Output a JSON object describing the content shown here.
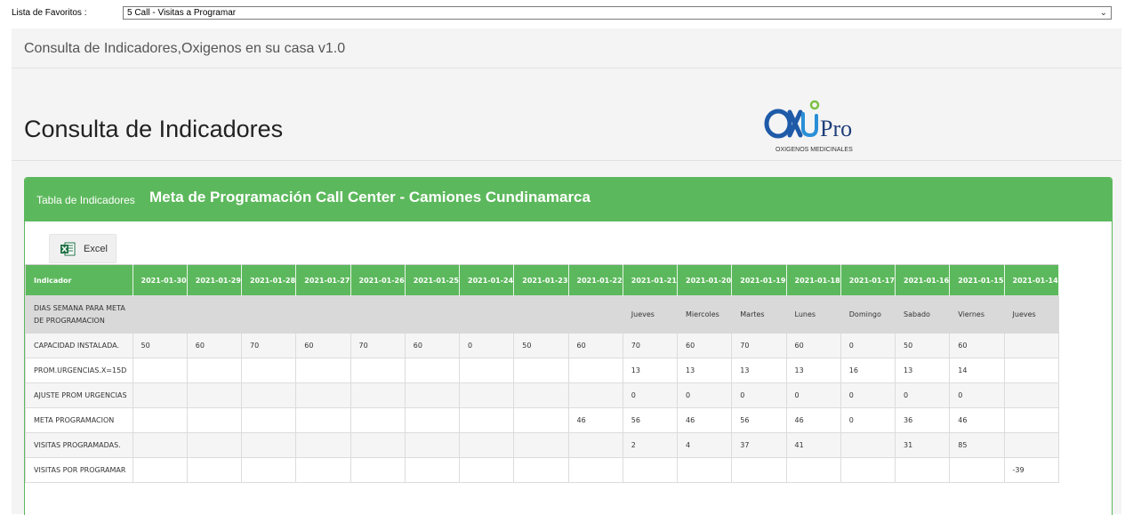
{
  "favorites": {
    "label": "Lista de Favoritos :",
    "selected": "5 Call - Visitas a Programar"
  },
  "app_title": "Consulta de Indicadores,Oxigenos en su casa v1.0",
  "page_title": "Consulta de Indicadores",
  "logo": {
    "brand": "Pro",
    "tagline": "OXIGENOS MEDICINALES"
  },
  "card": {
    "label": "Tabla de Indicadores",
    "title": "Meta de Programación Call Center - Camiones Cundinamarca"
  },
  "excel_button": {
    "label": "Excel"
  },
  "table": {
    "headers": [
      "Indicador",
      "2021-01-30",
      "2021-01-29",
      "2021-01-28",
      "2021-01-27",
      "2021-01-26",
      "2021-01-25",
      "2021-01-24",
      "2021-01-23",
      "2021-01-22",
      "2021-01-21",
      "2021-01-20",
      "2021-01-19",
      "2021-01-18",
      "2021-01-17",
      "2021-01-16",
      "2021-01-15",
      "2021-01-14"
    ],
    "rows": [
      [
        "DIAS SEMANA PARA META DE PROGRAMACION",
        "",
        "",
        "",
        "",
        "",
        "",
        "",
        "",
        "",
        "Jueves",
        "Miercoles",
        "Martes",
        "Lunes",
        "Domingo",
        "Sabado",
        "Viernes",
        "Jueves"
      ],
      [
        "CAPACIDAD INSTALADA.",
        "50",
        "60",
        "70",
        "60",
        "70",
        "60",
        "0",
        "50",
        "60",
        "70",
        "60",
        "70",
        "60",
        "0",
        "50",
        "60",
        ""
      ],
      [
        "PROM.URGENCIAS.X=15D",
        "",
        "",
        "",
        "",
        "",
        "",
        "",
        "",
        "",
        "13",
        "13",
        "13",
        "13",
        "16",
        "13",
        "14",
        ""
      ],
      [
        "AJUSTE PROM URGENCIAS",
        "",
        "",
        "",
        "",
        "",
        "",
        "",
        "",
        "",
        "0",
        "0",
        "0",
        "0",
        "0",
        "0",
        "0",
        ""
      ],
      [
        "META PROGRAMACION",
        "",
        "",
        "",
        "",
        "",
        "",
        "",
        "",
        "46",
        "56",
        "46",
        "56",
        "46",
        "0",
        "36",
        "46",
        ""
      ],
      [
        "VISITAS PROGRAMADAS.",
        "",
        "",
        "",
        "",
        "",
        "",
        "",
        "",
        "",
        "2",
        "4",
        "37",
        "41",
        "",
        "31",
        "85",
        ""
      ],
      [
        "VISITAS POR PROGRAMAR",
        "",
        "",
        "",
        "",
        "",
        "",
        "",
        "",
        "",
        "",
        "",
        "",
        "",
        "",
        "",
        "",
        "-39"
      ]
    ]
  },
  "colors": {
    "header_green": "#5cb85c",
    "panel_bg": "#f4f4f4",
    "logo_blue": "#1e5aa8",
    "logo_green": "#7cc142"
  }
}
